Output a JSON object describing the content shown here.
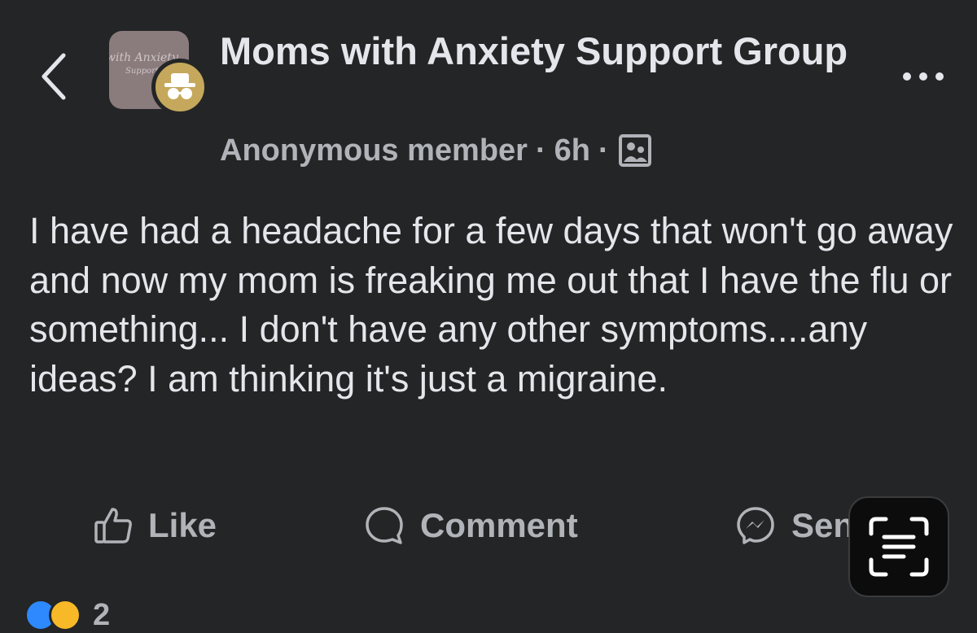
{
  "group": {
    "name": "Moms with Anxiety Support Group",
    "avatar_text_line1": "with Anxiety",
    "avatar_text_line2": "Support"
  },
  "post": {
    "author": "Anonymous member",
    "time": "6h",
    "separator": "·",
    "audience_icon": "group-audience-icon",
    "text": "I have had a headache for a few days that won't go away and now my mom is freaking me out that I have the flu or something... I don't have any other symptoms....any ideas? I am thinking it's just a migraine."
  },
  "actions": {
    "like": "Like",
    "comment": "Comment",
    "send": "Send"
  },
  "reactions": {
    "types": [
      "like",
      "care"
    ],
    "count": "2"
  },
  "colors": {
    "background": "#242526",
    "primary_text": "#e4e6eb",
    "secondary_text": "#b0b3b8",
    "anonymous_badge": "#c5a85c",
    "like_blue": "#2e89ff"
  }
}
